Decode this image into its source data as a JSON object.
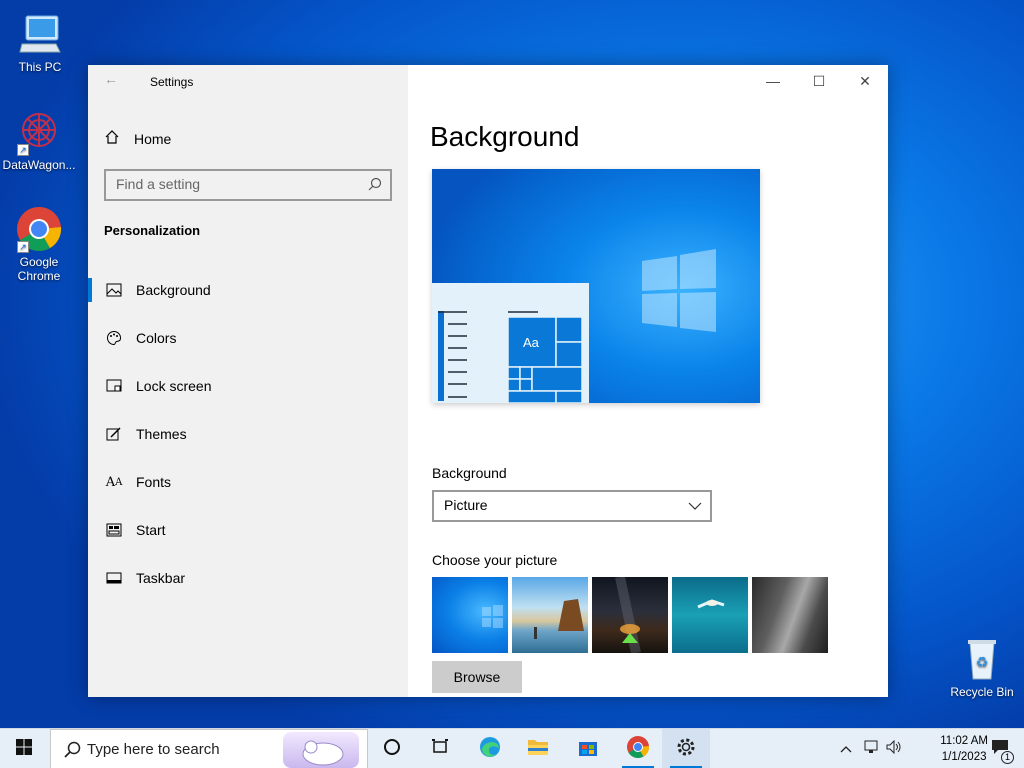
{
  "desktop": {
    "icons": [
      {
        "label": "This PC"
      },
      {
        "label": "DataWagon..."
      },
      {
        "label": "Google Chrome"
      },
      {
        "label": "Recycle Bin"
      }
    ]
  },
  "window": {
    "title": "Settings",
    "controls": {
      "minimize": "—",
      "maximize": "☐",
      "close": "✕"
    }
  },
  "sidebar": {
    "home": "Home",
    "search_placeholder": "Find a setting",
    "section": "Personalization",
    "items": [
      {
        "label": "Background",
        "icon": "picture-icon",
        "active": true
      },
      {
        "label": "Colors",
        "icon": "palette-icon"
      },
      {
        "label": "Lock screen",
        "icon": "lock-screen-icon"
      },
      {
        "label": "Themes",
        "icon": "brush-icon"
      },
      {
        "label": "Fonts",
        "icon": "font-icon"
      },
      {
        "label": "Start",
        "icon": "start-icon"
      },
      {
        "label": "Taskbar",
        "icon": "taskbar-icon"
      }
    ]
  },
  "main": {
    "title": "Background",
    "preview_tile_text": "Aa",
    "background_label": "Background",
    "background_value": "Picture",
    "choose_label": "Choose your picture",
    "browse_label": "Browse",
    "thumbnails": [
      "windows-blue",
      "beach-rocks",
      "night-sky-tent",
      "underwater-swimmer",
      "rock-cliff"
    ]
  },
  "taskbar": {
    "search_placeholder": "Type here to search",
    "time": "11:02 AM",
    "date": "1/1/2023",
    "notification_count": "1"
  },
  "colors": {
    "accent": "#0078d7",
    "sidebar_bg": "#f1f1f1"
  }
}
